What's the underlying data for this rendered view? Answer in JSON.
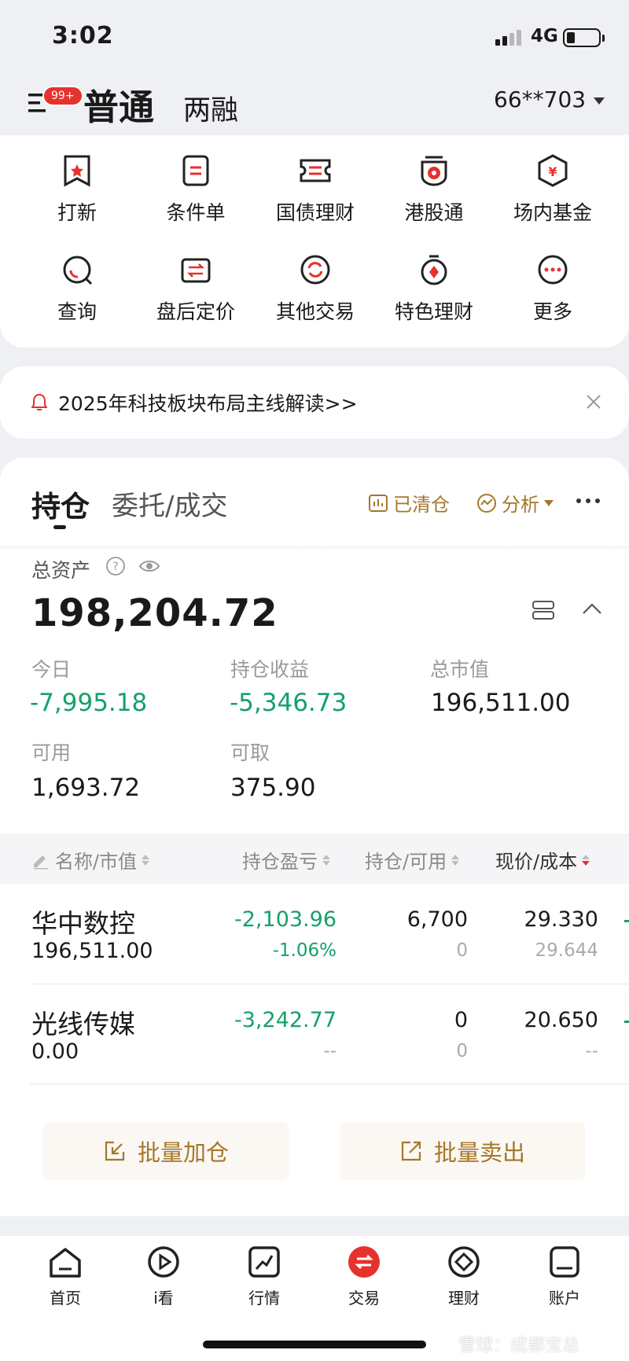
{
  "status": {
    "time": "3:02",
    "network": "4G"
  },
  "header": {
    "badge": "99+",
    "tab_active": "普通",
    "tab_other": "两融",
    "account": "66**703"
  },
  "grid": {
    "items": [
      {
        "label": "打新",
        "icon": "bookmark-star-icon"
      },
      {
        "label": "条件单",
        "icon": "document-icon"
      },
      {
        "label": "国债理财",
        "icon": "ticket-icon"
      },
      {
        "label": "港股通",
        "icon": "bauhinia-icon"
      },
      {
        "label": "场内基金",
        "icon": "yen-shield-icon"
      },
      {
        "label": "查询",
        "icon": "search-icon"
      },
      {
        "label": "盘后定价",
        "icon": "exchange-card-icon"
      },
      {
        "label": "其他交易",
        "icon": "refresh-icon"
      },
      {
        "label": "特色理财",
        "icon": "stopwatch-icon"
      },
      {
        "label": "更多",
        "icon": "more-icon"
      }
    ],
    "accent": "#e5322d"
  },
  "notice": {
    "text": "2025年科技板块布局主线解读>>"
  },
  "holdings": {
    "tabs": [
      "持仓",
      "委托/成交"
    ],
    "actions": {
      "cleared": "已清仓",
      "analysis": "分析"
    },
    "total_label": "总资产",
    "total": "198,204.72",
    "stats": [
      {
        "label": "今日",
        "value": "-7,995.18"
      },
      {
        "label": "持仓收益",
        "value": "-5,346.73"
      },
      {
        "label": "总市值",
        "value": "196,511.00"
      },
      {
        "label": "可用",
        "value": "1,693.72"
      },
      {
        "label": "可取",
        "value": "375.90"
      }
    ],
    "columns": [
      "名称/市值",
      "持仓盈亏",
      "持仓/可用",
      "现价/成本"
    ],
    "rows": [
      {
        "name": "华中数控",
        "market_value": "196,511.00",
        "pnl": "-2,103.96",
        "pnl_pct": "-1.06%",
        "position": "6,700",
        "available": "0",
        "price": "29.330",
        "cost": "29.644"
      },
      {
        "name": "光线传媒",
        "market_value": "0.00",
        "pnl": "-3,242.77",
        "pnl_pct": "--",
        "position": "0",
        "available": "0",
        "price": "20.650",
        "cost": "--"
      }
    ],
    "batch_buy": "批量加仓",
    "batch_sell": "批量卖出"
  },
  "nav": {
    "items": [
      {
        "label": "首页",
        "icon": "home-icon"
      },
      {
        "label": "i看",
        "icon": "play-icon"
      },
      {
        "label": "行情",
        "icon": "chart-icon"
      },
      {
        "label": "交易",
        "icon": "trade-icon"
      },
      {
        "label": "理财",
        "icon": "wealth-icon"
      },
      {
        "label": "账户",
        "icon": "account-icon"
      }
    ]
  },
  "watermark": "雪球：成都宝总",
  "colors": {
    "red": "#e5322d",
    "green": "#16a06a",
    "gold": "#a5772a"
  }
}
